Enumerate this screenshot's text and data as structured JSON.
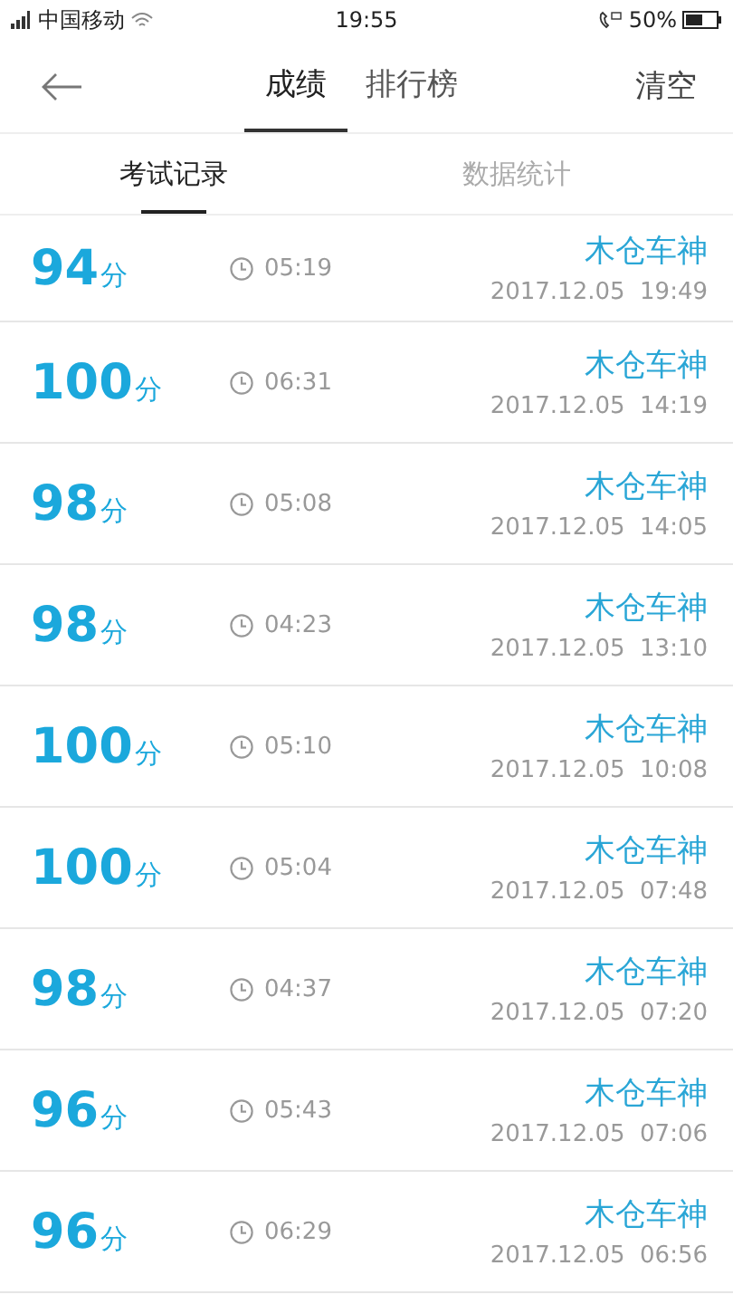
{
  "status_bar": {
    "carrier": "中国移动",
    "time": "19:55",
    "battery": "50%"
  },
  "header": {
    "tabs": [
      {
        "label": "成绩",
        "selected": true
      },
      {
        "label": "排行榜",
        "selected": false
      }
    ],
    "action": "清空"
  },
  "sub_tabs": [
    {
      "label": "考试记录",
      "selected": true
    },
    {
      "label": "数据统计",
      "selected": false
    }
  ],
  "records": [
    {
      "score": "94",
      "unit": "分",
      "duration": "05:19",
      "name": "木仓车神",
      "date": "2017.12.05  19:49"
    },
    {
      "score": "100",
      "unit": "分",
      "duration": "06:31",
      "name": "木仓车神",
      "date": "2017.12.05  14:19"
    },
    {
      "score": "98",
      "unit": "分",
      "duration": "05:08",
      "name": "木仓车神",
      "date": "2017.12.05  14:05"
    },
    {
      "score": "98",
      "unit": "分",
      "duration": "04:23",
      "name": "木仓车神",
      "date": "2017.12.05  13:10"
    },
    {
      "score": "100",
      "unit": "分",
      "duration": "05:10",
      "name": "木仓车神",
      "date": "2017.12.05  10:08"
    },
    {
      "score": "100",
      "unit": "分",
      "duration": "05:04",
      "name": "木仓车神",
      "date": "2017.12.05  07:48"
    },
    {
      "score": "98",
      "unit": "分",
      "duration": "04:37",
      "name": "木仓车神",
      "date": "2017.12.05  07:20"
    },
    {
      "score": "96",
      "unit": "分",
      "duration": "05:43",
      "name": "木仓车神",
      "date": "2017.12.05  07:06"
    },
    {
      "score": "96",
      "unit": "分",
      "duration": "06:29",
      "name": "木仓车神",
      "date": "2017.12.05  06:56"
    }
  ]
}
